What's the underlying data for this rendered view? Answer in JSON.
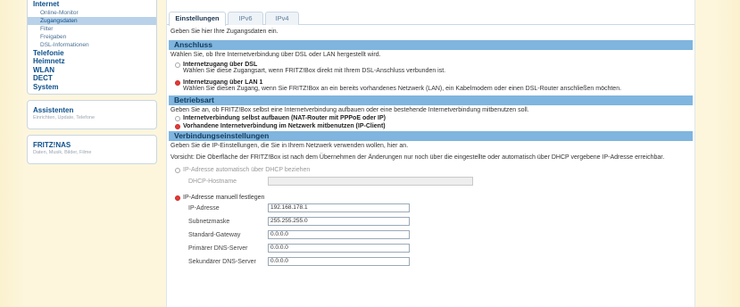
{
  "sidebar": {
    "nav": [
      {
        "label": "Internet",
        "level": "top"
      },
      {
        "label": "Online-Monitor",
        "level": "sub"
      },
      {
        "label": "Zugangsdaten",
        "level": "sub",
        "active": true
      },
      {
        "label": "Filter",
        "level": "sub"
      },
      {
        "label": "Freigaben",
        "level": "sub"
      },
      {
        "label": "DSL-Informationen",
        "level": "sub"
      },
      {
        "label": "Telefonie",
        "level": "top"
      },
      {
        "label": "Heimnetz",
        "level": "top"
      },
      {
        "label": "WLAN",
        "level": "top"
      },
      {
        "label": "DECT",
        "level": "top"
      },
      {
        "label": "System",
        "level": "top"
      }
    ],
    "assistenten": {
      "title": "Assistenten",
      "desc": "Einrichten, Update, Telefone"
    },
    "fritznas": {
      "title": "FRITZ!NAS",
      "desc": "Daten, Musik, Bilder, Filme"
    }
  },
  "tabs": [
    "Einstellungen",
    "IPv6",
    "IPv4"
  ],
  "intro": "Geben Sie hier Ihre Zugangsdaten ein.",
  "anschluss": {
    "header": "Anschluss",
    "text": "Wählen Sie, ob Ihre Internetverbindung über DSL oder LAN hergestellt wird.",
    "opt1_label": "Internetzugang über DSL",
    "opt1_desc": "Wählen Sie diese Zugangsart, wenn FRITZ!Box direkt mit Ihrem DSL-Anschluss verbunden ist.",
    "opt2_label": "Internetzugang über LAN 1",
    "opt2_desc": "Wählen Sie diesen Zugang, wenn Sie FRITZ!Box an ein bereits vorhandenes Netzwerk (LAN), ein Kabelmodem oder einen DSL-Router anschließen möchten."
  },
  "betriebsart": {
    "header": "Betriebsart",
    "text": "Geben Sie an, ob FRITZ!Box selbst eine Internetverbindung aufbauen oder eine bestehende Internetverbindung mitbenutzen soll.",
    "opt1_label": "Internetverbindung selbst aufbauen (NAT-Router mit PPPoE oder IP)",
    "opt2_label": "Vorhandene Internetverbindung im Netzwerk mitbenutzen (IP-Client)"
  },
  "verbindung": {
    "header": "Verbindungseinstellungen",
    "text": "Geben Sie die IP-Einstellungen, die Sie in Ihrem Netzwerk verwenden wollen, hier an.",
    "warning": "Vorsicht: Die Oberfläche der FRITZ!Box ist nach dem Übernehmen der Änderungen nur noch über die eingestellte oder automatisch über DHCP vergebene IP-Adresse erreichbar.",
    "dhcp_label": "IP-Adresse automatisch über DHCP beziehen",
    "hostname_label": "DHCP-Hostname",
    "hostname_value": "",
    "manual_label": "IP-Adresse manuell festlegen",
    "fields": [
      {
        "label": "IP-Adresse",
        "value": "192.168.178.1"
      },
      {
        "label": "Subnetzmaske",
        "value": "255.255.255.0"
      },
      {
        "label": "Standard-Gateway",
        "value": "0.0.0.0"
      },
      {
        "label": "Primärer DNS-Server",
        "value": "0.0.0.0"
      },
      {
        "label": "Sekundärer DNS-Server",
        "value": "0.0.0.0"
      }
    ]
  }
}
